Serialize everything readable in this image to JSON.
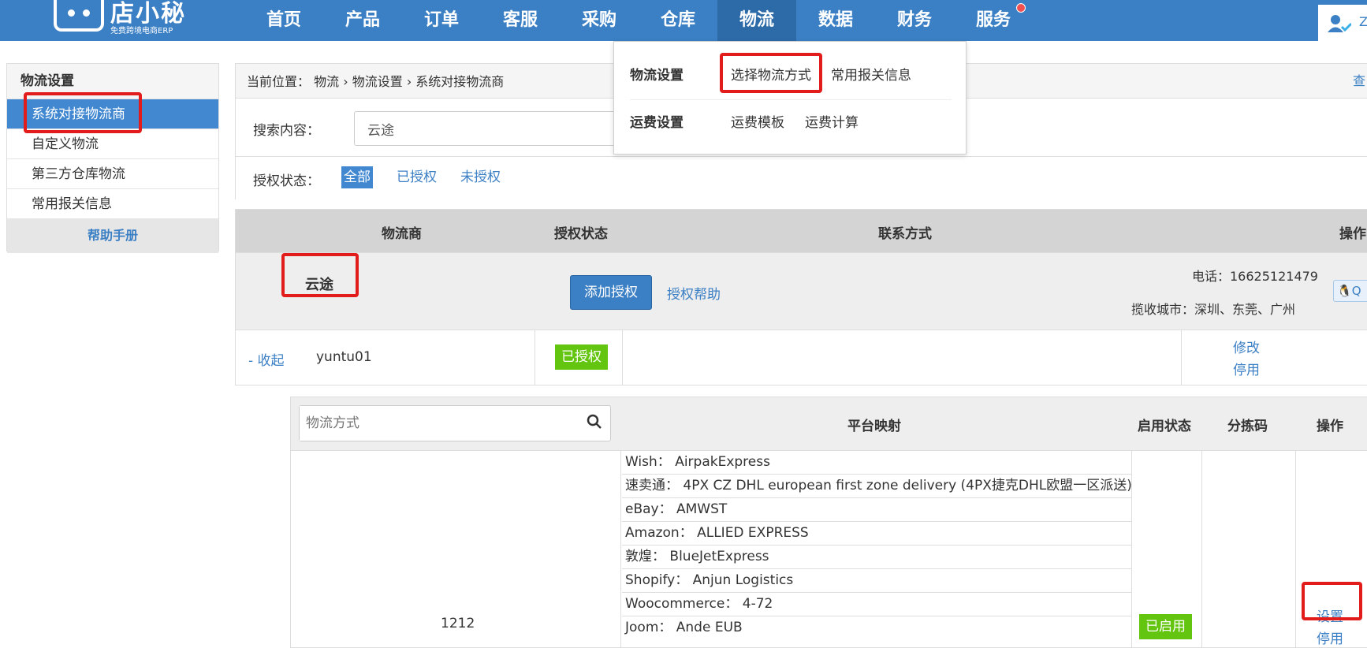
{
  "brand": {
    "name": "店小秘",
    "subtitle": "免费跨境电商ERP"
  },
  "nav": {
    "items": [
      "首页",
      "产品",
      "订单",
      "客服",
      "采购",
      "仓库",
      "物流",
      "数据",
      "财务",
      "服务"
    ],
    "active": "物流",
    "user_initial": "Z"
  },
  "sidebar": {
    "title": "物流设置",
    "items": [
      "系统对接物流商",
      "自定义物流",
      "第三方仓库物流",
      "常用报关信息"
    ],
    "active": "系统对接物流商",
    "help": "帮助手册"
  },
  "breadcrumb": {
    "prefix": "当前位置：",
    "path": [
      "物流",
      "物流设置",
      "系统对接物流商"
    ],
    "right_link": "查"
  },
  "search": {
    "label": "搜索内容：",
    "value": "云途"
  },
  "auth_filter": {
    "label": "授权状态：",
    "options": [
      "全部",
      "已授权",
      "未授权"
    ],
    "selected": "全部"
  },
  "grid": {
    "headers": [
      "物流商",
      "授权状态",
      "联系方式",
      "操作"
    ],
    "vendor": {
      "name": "云途",
      "add_button": "添加授权",
      "help_link": "授权帮助",
      "phone": "电话：16625121479",
      "cities": "揽收城市：深圳、东莞、广州",
      "qq": "Q"
    },
    "account": {
      "collapse": "- 收起",
      "name": "yuntu01",
      "status": "已授权",
      "ops": [
        "修改",
        "停用"
      ]
    }
  },
  "methods": {
    "search_placeholder": "物流方式",
    "headers": [
      "平台映射",
      "启用状态",
      "分拣码",
      "操作"
    ],
    "row": {
      "id": "1212",
      "mappings": [
        "Wish：  AirpakExpress",
        "速卖通：  4PX CZ DHL european first zone delivery (4PX捷克DHL欧盟一区派送)",
        "eBay：  AMWST",
        "Amazon：  ALLIED EXPRESS",
        "敦煌：  BlueJetExpress",
        "Shopify：  Anjun Logistics",
        "Woocommerce：  4-72",
        "Joom：  Ande EUB"
      ],
      "status": "已启用",
      "ops": [
        "设置",
        "停用"
      ]
    }
  },
  "dropdown": {
    "groups": [
      {
        "label": "物流设置",
        "links": [
          "选择物流方式",
          "常用报关信息"
        ]
      },
      {
        "label": "运费设置",
        "links": [
          "运费模板",
          "运费计算"
        ]
      }
    ]
  },
  "colors": {
    "primary": "#3b7fc4",
    "highlight": "#e21b1b",
    "success": "#63c50f"
  }
}
